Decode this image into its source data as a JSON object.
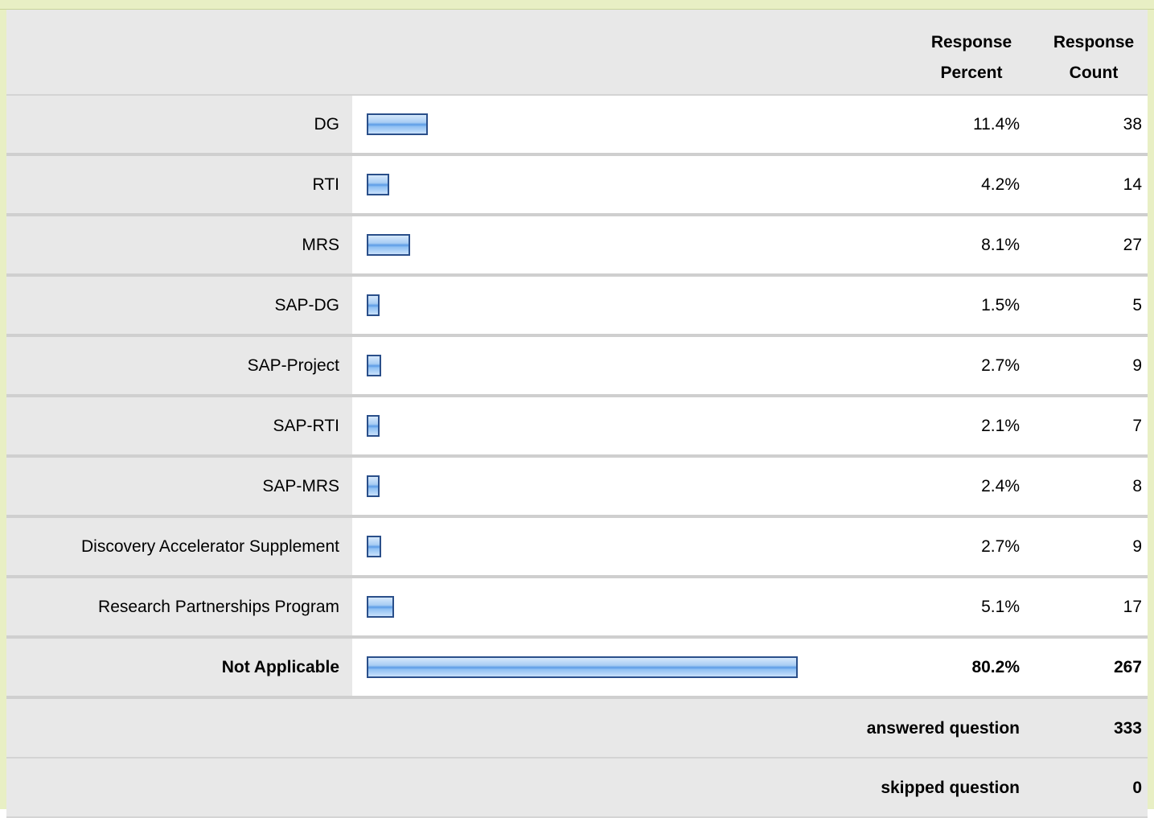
{
  "header": {
    "percent_line1": "Response",
    "percent_line2": "Percent",
    "count_line1": "Response",
    "count_line2": "Count"
  },
  "rows": [
    {
      "label": "DG",
      "percent": "11.4%",
      "count": "38",
      "bar_fraction": 0.114
    },
    {
      "label": "RTI",
      "percent": "4.2%",
      "count": "14",
      "bar_fraction": 0.042
    },
    {
      "label": "MRS",
      "percent": "8.1%",
      "count": "27",
      "bar_fraction": 0.081
    },
    {
      "label": "SAP-DG",
      "percent": "1.5%",
      "count": "5",
      "bar_fraction": 0.015
    },
    {
      "label": "SAP-Project",
      "percent": "2.7%",
      "count": "9",
      "bar_fraction": 0.027
    },
    {
      "label": "SAP-RTI",
      "percent": "2.1%",
      "count": "7",
      "bar_fraction": 0.021
    },
    {
      "label": "SAP-MRS",
      "percent": "2.4%",
      "count": "8",
      "bar_fraction": 0.024
    },
    {
      "label": "Discovery Accelerator Supplement",
      "percent": "2.7%",
      "count": "9",
      "bar_fraction": 0.027
    },
    {
      "label": "Research Partnerships Program",
      "percent": "5.1%",
      "count": "17",
      "bar_fraction": 0.051
    },
    {
      "label": "Not Applicable",
      "percent": "80.2%",
      "count": "267",
      "bar_fraction": 0.802
    }
  ],
  "summary": {
    "answered_label": "answered question",
    "answered_value": "333",
    "skipped_label": "skipped question",
    "skipped_value": "0"
  },
  "colors": {
    "label_bg": "#e8e8e8",
    "bar_fill": "#5b9be6",
    "bar_border": "#2a4f8a",
    "frame_accent": "#e8efc4"
  }
}
